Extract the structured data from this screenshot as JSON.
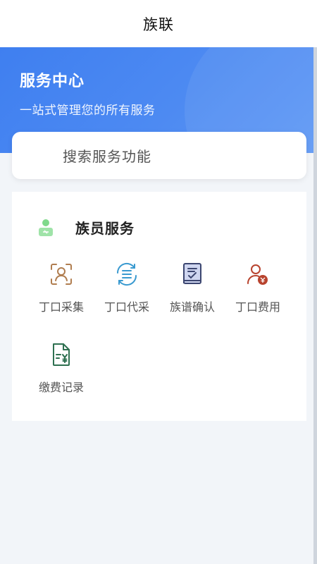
{
  "app": {
    "title": "族联"
  },
  "hero": {
    "title": "服务中心",
    "subtitle": "一站式管理您的所有服务"
  },
  "search": {
    "placeholder": "搜索服务功能"
  },
  "section": {
    "title": "族员服务",
    "items": [
      {
        "label": "丁口采集",
        "icon": "face-scan-icon",
        "color": "#b07d4f"
      },
      {
        "label": "丁口代采",
        "icon": "sync-list-icon",
        "color": "#3a9ad0"
      },
      {
        "label": "族谱确认",
        "icon": "book-check-icon",
        "color": "#3c4670"
      },
      {
        "label": "丁口费用",
        "icon": "user-money-icon",
        "color": "#b8432e"
      },
      {
        "label": "缴费记录",
        "icon": "payment-doc-icon",
        "color": "#2e7050"
      }
    ]
  },
  "colors": {
    "accent": "#3f7ff0",
    "section_icon": "#7fd98b"
  }
}
